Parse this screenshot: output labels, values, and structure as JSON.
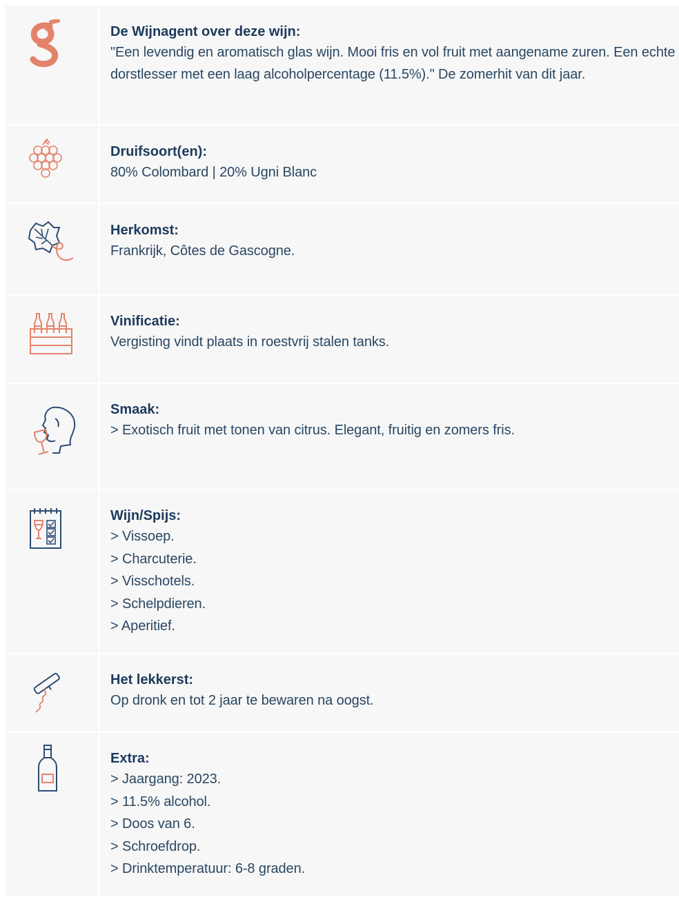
{
  "rows": [
    {
      "icon": "wijnagent-logo-icon",
      "title": "De Wijnagent over deze wijn:",
      "body": "\"Een levendig en aromatisch glas wijn. Mooi fris en vol fruit met aangename zuren. Een echte dorstlesser met een laag alcoholpercentage (11.5%).\" De zomerhit van dit jaar."
    },
    {
      "icon": "grapes-icon",
      "title": "Druifsoort(en):",
      "body": "80% Colombard | 20% Ugni Blanc"
    },
    {
      "icon": "vine-leaf-icon",
      "title": "Herkomst:",
      "body": "Frankrijk, Côtes de Gascogne."
    },
    {
      "icon": "wine-crate-icon",
      "title": "Vinificatie:",
      "body": "Vergisting vindt plaats in roestvrij stalen tanks."
    },
    {
      "icon": "tasting-head-icon",
      "title": "Smaak:",
      "body": "> Exotisch fruit met tonen van citrus. Elegant, fruitig en zomers fris."
    },
    {
      "icon": "menu-checklist-icon",
      "title": "Wijn/Spijs:",
      "lines": [
        "> Vissoep.",
        "> Charcuterie.",
        "> Visschotels.",
        "> Schelpdieren.",
        "> Aperitief."
      ]
    },
    {
      "icon": "corkscrew-icon",
      "title": "Het lekkerst:",
      "body": "Op dronk en tot 2 jaar te bewaren na oogst."
    },
    {
      "icon": "wine-bottle-icon",
      "title": "Extra:",
      "lines": [
        "> Jaargang: 2023.",
        "> 11.5% alcohol.",
        "> Doos van 6.",
        "> Schroefdrop.",
        "> Drinktemperatuur: 6-8 graden."
      ]
    }
  ],
  "colors": {
    "accent": "#e4836b",
    "navy": "#1c3a5c",
    "row_bg": "#f7f7f7"
  }
}
